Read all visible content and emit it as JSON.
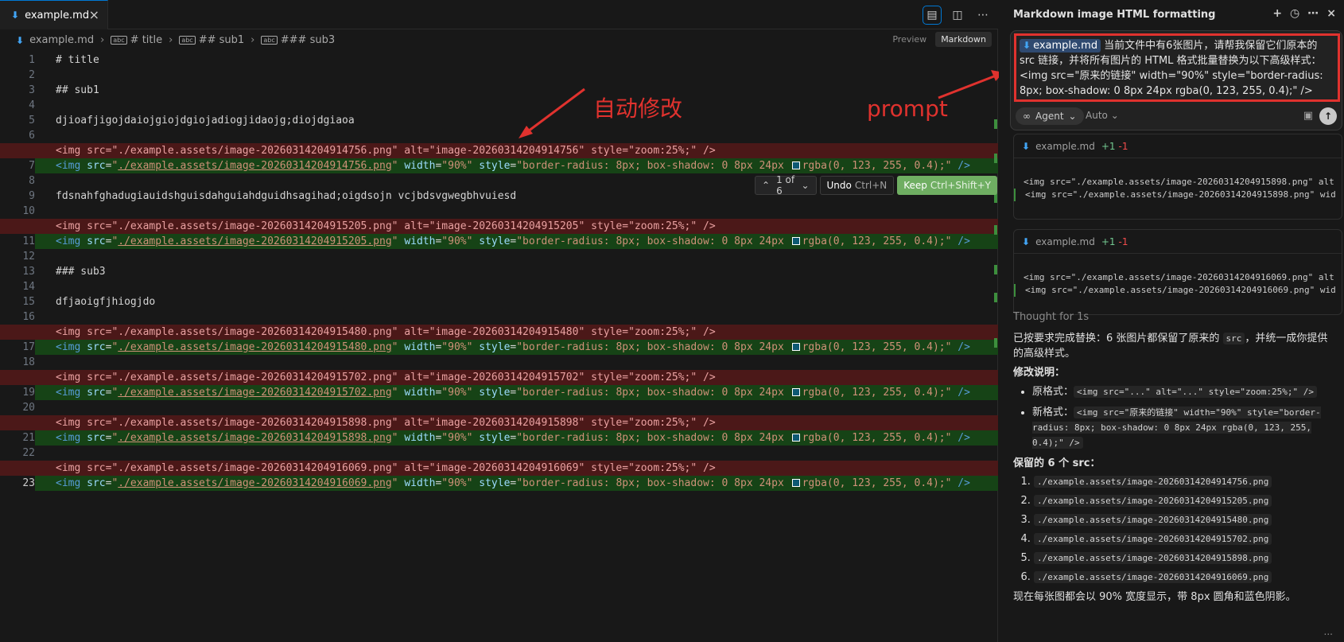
{
  "tab": {
    "filename": "example.md",
    "close_glyph": "×"
  },
  "tab_actions": [
    "layout-icon",
    "split-editor-icon",
    "more-icon"
  ],
  "breadcrumb": {
    "file": "example.md",
    "items": [
      "# title",
      "## sub1",
      "### sub3"
    ]
  },
  "modes": {
    "preview": "Preview",
    "markdown": "Markdown"
  },
  "code": {
    "l1": "# title",
    "l3": "## sub1",
    "l5": "djioafjigojdaiojgiojdgiojadiogjidaojg;diojdgiaoa",
    "l9": "fdsnahfghadugiauidshguisdahguiahdguidhsagihad;oigdsojn vcjbdsvgwegbhvuiesd",
    "l13": "### sub3",
    "l15": "dfjaoigfjhiogjdo",
    "img_ids": [
      "20260314204914756",
      "20260314204915205",
      "20260314204915480",
      "20260314204915702",
      "20260314204915898",
      "20260314204916069"
    ],
    "current_line": 23
  },
  "diff_toolbar": {
    "counter": "1 of 6",
    "undo_label": "Undo",
    "undo_key": "Ctrl+N",
    "keep_label": "Keep",
    "keep_key": "Ctrl+Shift+Y"
  },
  "annotations": {
    "auto_edit": "自动修改",
    "prompt": "prompt",
    "color": "#e0322e"
  },
  "chat": {
    "title": "Markdown image HTML formatting",
    "prompt_chip": "example.md",
    "prompt_text": "当前文件中有6张图片，请帮我保留它们原本的 src 链接，并将所有图片的 HTML 格式批量替换为以下高级样式：",
    "prompt_code": "<img src=\"原来的链接\" width=\"90%\" style=\"border-radius: 8px; box-shadow: 0 8px 24px rgba(0, 123, 255, 0.4);\" />",
    "agent_label": "Agent",
    "auto_label": "Auto",
    "cards": [
      {
        "file": "example.md",
        "plus": "+1",
        "minus": "-1",
        "del": "<img src=\"./example.assets/image-20260314204915898.png\" alt",
        "add": "<img src=\"./example.assets/image-20260314204915898.png\" wid"
      },
      {
        "file": "example.md",
        "plus": "+1",
        "minus": "-1",
        "del": "<img src=\"./example.assets/image-20260314204916069.png\" alt",
        "add": "<img src=\"./example.assets/image-20260314204916069.png\" wid"
      }
    ],
    "thought": "Thought for 1s",
    "summary_a": "已按要求完成替换：6 张图片都保留了原来的 ",
    "summary_code": "src",
    "summary_b": "，并统一成你提供的高级样式。",
    "changes_heading": "修改说明：",
    "old_label": "原格式：",
    "old_code": "<img src=\"...\" alt=\"...\" style=\"zoom:25%;\" />",
    "new_label": "新格式：",
    "new_code": "<img src=\"原来的链接\" width=\"90%\" style=\"border-radius: 8px; box-shadow: 0 8px 24px rgba(0, 123, 255, 0.4);\" />",
    "kept_heading": "保留的 6 个 src：",
    "srcs": [
      "./example.assets/image-20260314204914756.png",
      "./example.assets/image-20260314204915205.png",
      "./example.assets/image-20260314204915480.png",
      "./example.assets/image-20260314204915702.png",
      "./example.assets/image-20260314204915898.png",
      "./example.assets/image-20260314204916069.png"
    ],
    "footer": "现在每张图都会以 90% 宽度显示，带 8px 圆角和蓝色阴影。",
    "more": "..."
  }
}
